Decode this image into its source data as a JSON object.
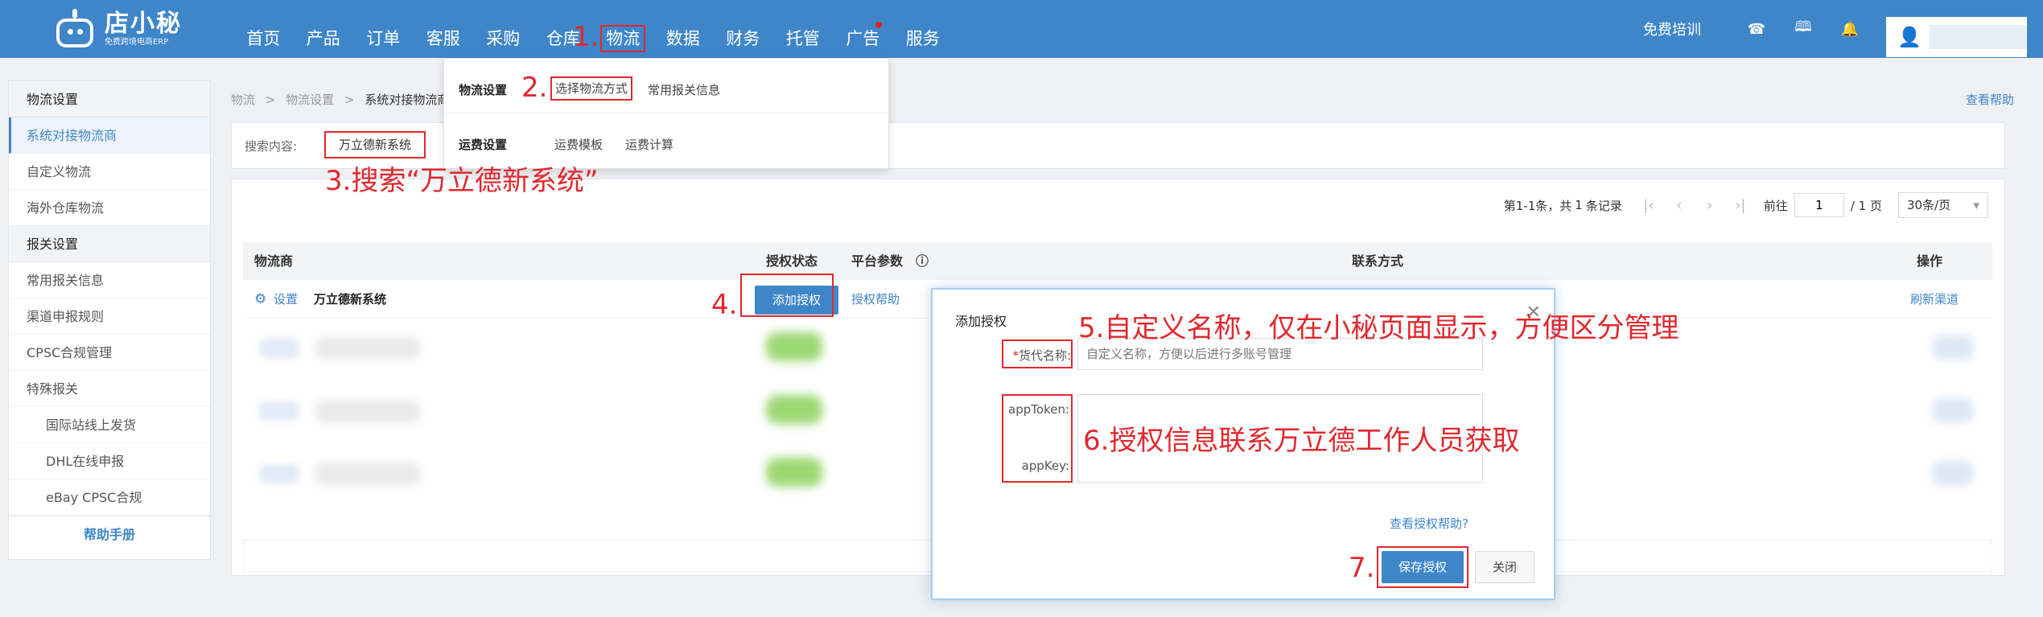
{
  "header": {
    "logo_title": "店小秘",
    "logo_subtitle": "免费跨境电商ERP",
    "nav": [
      "首页",
      "产品",
      "订单",
      "客服",
      "采购",
      "仓库",
      "物流",
      "数据",
      "财务",
      "托管",
      "广告",
      "服务"
    ],
    "free_training": "免费培训"
  },
  "dropdown": {
    "row1_title": "物流设置",
    "row1_link1": "选择物流方式",
    "row1_link2": "常用报关信息",
    "row2_title": "运费设置",
    "row2_link1": "运费模板",
    "row2_link2": "运费计算"
  },
  "sidebar": {
    "group1": "物流设置",
    "item1": "系统对接物流商",
    "item2": "自定义物流",
    "item3": "海外仓库物流",
    "group2": "报关设置",
    "item4": "常用报关信息",
    "item5": "渠道申报规则",
    "item6": "CPSC合规管理",
    "item7": "特殊报关",
    "item8": "国际站线上发货",
    "item9": "DHL在线申报",
    "item10": "eBay CPSC合规",
    "help": "帮助手册"
  },
  "breadcrumb": {
    "p1": "物流",
    "sep": ">",
    "p2": "物流设置",
    "p3": "系统对接物流商"
  },
  "help_link": "查看帮助",
  "search": {
    "label": "搜索内容:",
    "value": "万立德新系统"
  },
  "pager": {
    "summary_prefix": "第1-1条，共",
    "summary_count": "1",
    "summary_suffix": "条记录",
    "goto_label": "前往",
    "page_value": "1",
    "total_pages": "/ 1 页",
    "page_size": "30条/页"
  },
  "table": {
    "col_carrier": "物流商",
    "col_status": "授权状态",
    "col_params": "平台参数",
    "col_contact": "联系方式",
    "col_ops": "操作",
    "row_settings": "设置",
    "row_carrier": "万立德新系统",
    "row_auth_btn": "添加授权",
    "row_auth_help": "授权帮助",
    "row_refresh": "刷新渠道"
  },
  "modal": {
    "title": "添加授权",
    "req_mark": "*",
    "name_label": "货代名称:",
    "name_placeholder": "自定义名称，方便以后进行多账号管理",
    "token_label": "appToken:",
    "key_label": "appKey:",
    "help_link": "查看授权帮助?",
    "save": "保存授权",
    "close": "关闭"
  },
  "annotations": {
    "a1": "1.",
    "a2": "2.",
    "a3": "3.搜索“万立德新系统”",
    "a4": "4.",
    "a5": "5.自定义名称，仅在小秘页面显示，方便区分管理",
    "a6": "6.授权信息联系万立德工作人员获取",
    "a7": "7."
  },
  "colors": {
    "brand": "#3f86c9",
    "annotation": "#e0282e"
  }
}
